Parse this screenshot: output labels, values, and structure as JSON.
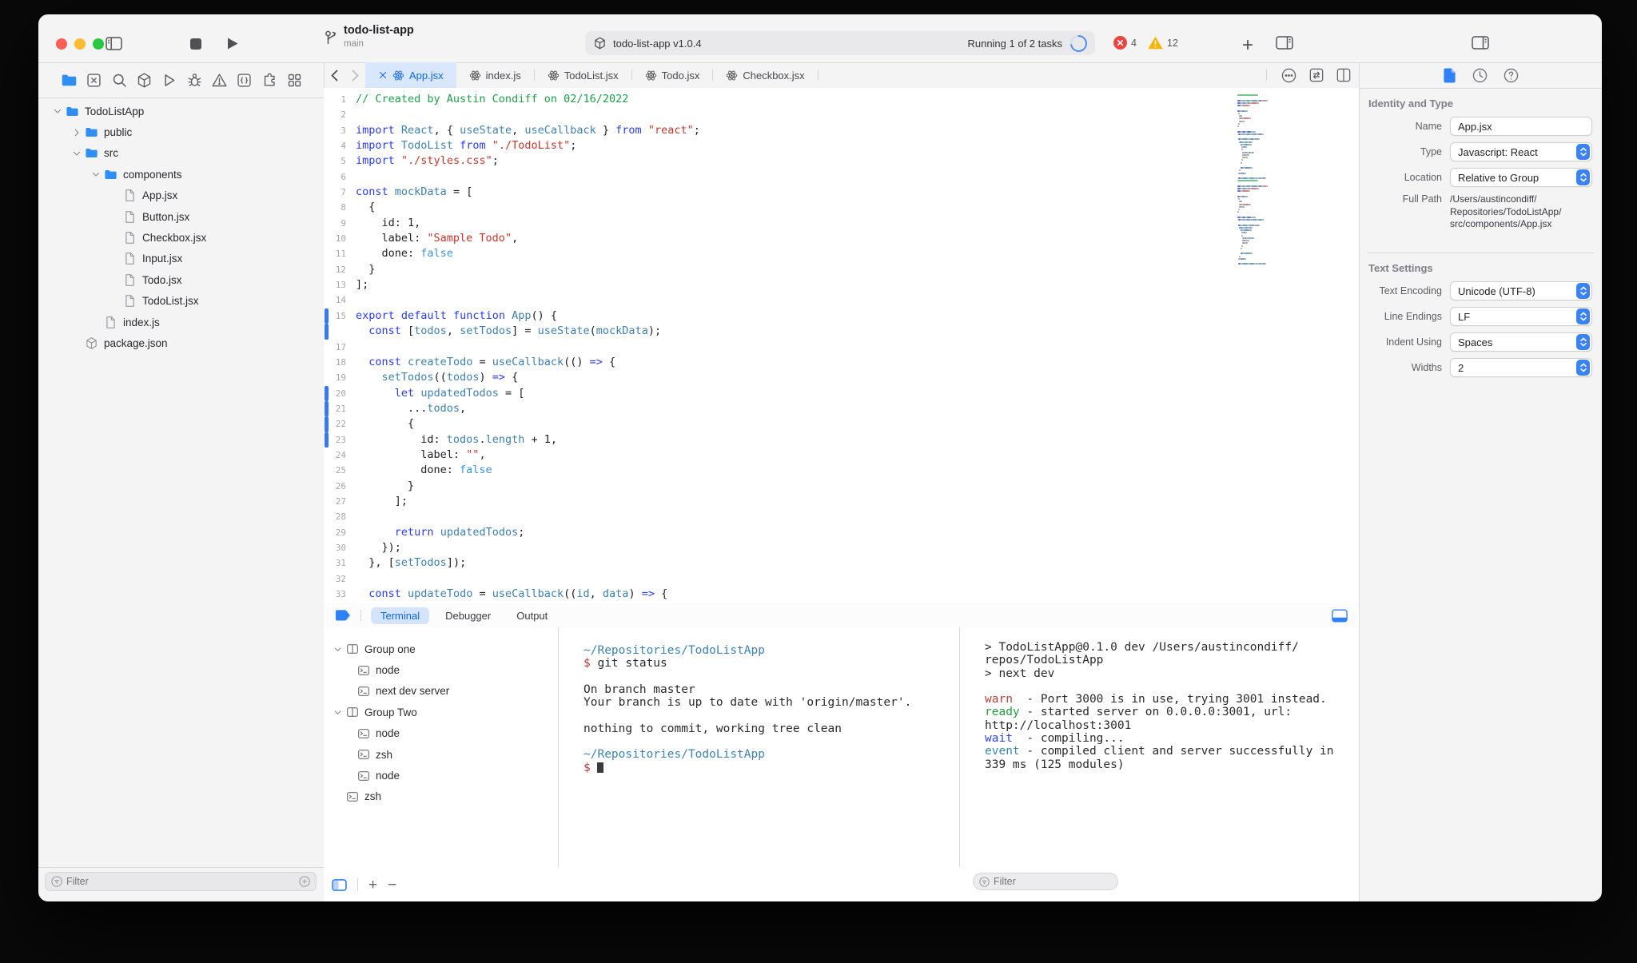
{
  "titlebar": {
    "project": "todo-list-app",
    "branch": "main",
    "status_left": "todo-list-app v1.0.4",
    "status_right": "Running 1 of 2 tasks",
    "errors": "4",
    "warnings": "12"
  },
  "navigator": {
    "filter_placeholder": "Filter",
    "tree": [
      {
        "label": "TodoListApp",
        "icon": "folder",
        "depth": 0,
        "chevron": "down"
      },
      {
        "label": "public",
        "icon": "folder",
        "depth": 1,
        "chevron": "right"
      },
      {
        "label": "src",
        "icon": "folder",
        "depth": 1,
        "chevron": "down"
      },
      {
        "label": "components",
        "icon": "folder",
        "depth": 2,
        "chevron": "down"
      },
      {
        "label": "App.jsx",
        "icon": "file",
        "depth": 3,
        "selected": true
      },
      {
        "label": "Button.jsx",
        "icon": "file",
        "depth": 3
      },
      {
        "label": "Checkbox.jsx",
        "icon": "file",
        "depth": 3
      },
      {
        "label": "Input.jsx",
        "icon": "file",
        "depth": 3
      },
      {
        "label": "Todo.jsx",
        "icon": "file",
        "depth": 3
      },
      {
        "label": "TodoList.jsx",
        "icon": "file",
        "depth": 3
      },
      {
        "label": "index.js",
        "icon": "file",
        "depth": 2
      },
      {
        "label": "package.json",
        "icon": "package",
        "depth": 1
      }
    ]
  },
  "tabs": [
    {
      "label": "App.jsx",
      "active": true
    },
    {
      "label": "index.js"
    },
    {
      "label": "TodoList.jsx"
    },
    {
      "label": "Todo.jsx"
    },
    {
      "label": "Checkbox.jsx"
    }
  ],
  "editor": {
    "lines": [
      {
        "n": "1",
        "seg": [
          [
            "cmt",
            "// Created by Austin Condiff on 02/16/2022"
          ]
        ]
      },
      {
        "n": "2",
        "seg": []
      },
      {
        "n": "3",
        "seg": [
          [
            "kw",
            "import"
          ],
          [
            "pln",
            " "
          ],
          [
            "id",
            "React"
          ],
          [
            "pln",
            ", { "
          ],
          [
            "id",
            "useState"
          ],
          [
            "pln",
            ", "
          ],
          [
            "id",
            "useCallback"
          ],
          [
            "pln",
            " } "
          ],
          [
            "kw",
            "from"
          ],
          [
            "pln",
            " "
          ],
          [
            "str",
            "\"react\""
          ],
          [
            "pln",
            ";"
          ]
        ]
      },
      {
        "n": "4",
        "seg": [
          [
            "kw",
            "import"
          ],
          [
            "pln",
            " "
          ],
          [
            "id",
            "TodoList"
          ],
          [
            "pln",
            " "
          ],
          [
            "kw",
            "from"
          ],
          [
            "pln",
            " "
          ],
          [
            "str",
            "\"./TodoList\""
          ],
          [
            "pln",
            ";"
          ]
        ]
      },
      {
        "n": "5",
        "seg": [
          [
            "kw",
            "import"
          ],
          [
            "pln",
            " "
          ],
          [
            "str",
            "\"./styles.css\""
          ],
          [
            "pln",
            ";"
          ]
        ]
      },
      {
        "n": "6",
        "seg": []
      },
      {
        "n": "7",
        "seg": [
          [
            "kw",
            "const"
          ],
          [
            "pln",
            " "
          ],
          [
            "id",
            "mockData"
          ],
          [
            "pln",
            " = ["
          ]
        ]
      },
      {
        "n": "8",
        "seg": [
          [
            "pln",
            "  {"
          ]
        ]
      },
      {
        "n": "9",
        "seg": [
          [
            "pln",
            "    id: 1,"
          ]
        ]
      },
      {
        "n": "10",
        "seg": [
          [
            "pln",
            "    label: "
          ],
          [
            "str",
            "\"Sample Todo\""
          ],
          [
            "pln",
            ","
          ]
        ]
      },
      {
        "n": "11",
        "seg": [
          [
            "pln",
            "    done: "
          ],
          [
            "lit",
            "false"
          ]
        ]
      },
      {
        "n": "12",
        "seg": [
          [
            "pln",
            "  }"
          ]
        ]
      },
      {
        "n": "13",
        "seg": [
          [
            "pln",
            "];"
          ]
        ]
      },
      {
        "n": "14",
        "seg": []
      },
      {
        "n": "15",
        "bar": true,
        "seg": [
          [
            "kw",
            "export"
          ],
          [
            "pln",
            " "
          ],
          [
            "kw",
            "default"
          ],
          [
            "pln",
            " "
          ],
          [
            "kw",
            "function"
          ],
          [
            "pln",
            " "
          ],
          [
            "id",
            "App"
          ],
          [
            "pln",
            "() {"
          ]
        ]
      },
      {
        "n": "",
        "bar": true,
        "seg": [
          [
            "pln",
            "  "
          ],
          [
            "kw",
            "const"
          ],
          [
            "pln",
            " ["
          ],
          [
            "id",
            "todos"
          ],
          [
            "pln",
            ", "
          ],
          [
            "id",
            "setTodos"
          ],
          [
            "pln",
            "] = "
          ],
          [
            "id",
            "useState"
          ],
          [
            "pln",
            "("
          ],
          [
            "id",
            "mockData"
          ],
          [
            "pln",
            ");"
          ]
        ]
      },
      {
        "n": "17",
        "seg": []
      },
      {
        "n": "18",
        "seg": [
          [
            "pln",
            "  "
          ],
          [
            "kw",
            "const"
          ],
          [
            "pln",
            " "
          ],
          [
            "id",
            "createTodo"
          ],
          [
            "pln",
            " = "
          ],
          [
            "id",
            "useCallback"
          ],
          [
            "pln",
            "(() "
          ],
          [
            "kw",
            "=>"
          ],
          [
            "pln",
            " {"
          ]
        ]
      },
      {
        "n": "19",
        "seg": [
          [
            "pln",
            "    "
          ],
          [
            "id",
            "setTodos"
          ],
          [
            "pln",
            "(("
          ],
          [
            "id",
            "todos"
          ],
          [
            "pln",
            ") "
          ],
          [
            "kw",
            "=>"
          ],
          [
            "pln",
            " {"
          ]
        ]
      },
      {
        "n": "20",
        "bar": true,
        "seg": [
          [
            "pln",
            "      "
          ],
          [
            "kw",
            "let"
          ],
          [
            "pln",
            " "
          ],
          [
            "id",
            "updatedTodos"
          ],
          [
            "pln",
            " = ["
          ]
        ]
      },
      {
        "n": "21",
        "bar": true,
        "seg": [
          [
            "pln",
            "        ..."
          ],
          [
            "id",
            "todos"
          ],
          [
            "pln",
            ","
          ]
        ]
      },
      {
        "n": "22",
        "bar": true,
        "seg": [
          [
            "pln",
            "        {"
          ]
        ]
      },
      {
        "n": "23",
        "bar": true,
        "seg": [
          [
            "pln",
            "          id: "
          ],
          [
            "id",
            "todos"
          ],
          [
            "pln",
            "."
          ],
          [
            "id",
            "length"
          ],
          [
            "pln",
            " + 1,"
          ]
        ]
      },
      {
        "n": "24",
        "seg": [
          [
            "pln",
            "          label: "
          ],
          [
            "str",
            "\"\""
          ],
          [
            "pln",
            ","
          ]
        ]
      },
      {
        "n": "25",
        "seg": [
          [
            "pln",
            "          done: "
          ],
          [
            "lit",
            "false"
          ]
        ]
      },
      {
        "n": "26",
        "seg": [
          [
            "pln",
            "        }"
          ]
        ]
      },
      {
        "n": "27",
        "seg": [
          [
            "pln",
            "      ];"
          ]
        ]
      },
      {
        "n": "28",
        "seg": []
      },
      {
        "n": "29",
        "seg": [
          [
            "pln",
            "      "
          ],
          [
            "kw",
            "return"
          ],
          [
            "pln",
            " "
          ],
          [
            "id",
            "updatedTodos"
          ],
          [
            "pln",
            ";"
          ]
        ]
      },
      {
        "n": "30",
        "seg": [
          [
            "pln",
            "    });"
          ]
        ]
      },
      {
        "n": "31",
        "seg": [
          [
            "pln",
            "  }, ["
          ],
          [
            "id",
            "setTodos"
          ],
          [
            "pln",
            "]);"
          ]
        ]
      },
      {
        "n": "32",
        "seg": []
      },
      {
        "n": "33",
        "seg": [
          [
            "pln",
            "  "
          ],
          [
            "kw",
            "const"
          ],
          [
            "pln",
            " "
          ],
          [
            "id",
            "updateTodo"
          ],
          [
            "pln",
            " = "
          ],
          [
            "id",
            "useCallback"
          ],
          [
            "pln",
            "(("
          ],
          [
            "id",
            "id"
          ],
          [
            "pln",
            ", "
          ],
          [
            "id",
            "data"
          ],
          [
            "pln",
            ") "
          ],
          [
            "kw",
            "=>"
          ],
          [
            "pln",
            " {"
          ]
        ]
      }
    ]
  },
  "inspector": {
    "identity_title": "Identity and Type",
    "rows_identity": [
      {
        "label": "Name",
        "value": "App.jsx",
        "control": "input"
      },
      {
        "label": "Type",
        "value": "Javascript: React",
        "control": "select"
      },
      {
        "label": "Location",
        "value": "Relative to Group",
        "control": "select"
      },
      {
        "label": "Full Path",
        "value": "/Users/austincondiff/\nRepositories/TodoListApp/\nsrc/components/App.jsx",
        "control": "text"
      }
    ],
    "text_title": "Text Settings",
    "rows_text": [
      {
        "label": "Text Encoding",
        "value": "Unicode (UTF-8)",
        "control": "select"
      },
      {
        "label": "Line Endings",
        "value": "LF",
        "control": "select"
      },
      {
        "label": "Indent Using",
        "value": "Spaces",
        "control": "select"
      },
      {
        "label": "Widths",
        "value": "2",
        "control": "select"
      }
    ]
  },
  "panel": {
    "tabs": [
      {
        "label": "Terminal",
        "active": true
      },
      {
        "label": "Debugger"
      },
      {
        "label": "Output"
      }
    ],
    "sessions": [
      {
        "label": "Group one",
        "type": "group"
      },
      {
        "label": "node",
        "type": "session",
        "selected": true,
        "indent": 1
      },
      {
        "label": "next dev server",
        "type": "session",
        "indent": 1
      },
      {
        "label": "Group Two",
        "type": "group"
      },
      {
        "label": "node",
        "type": "session",
        "indent": 1
      },
      {
        "label": "zsh",
        "type": "session",
        "indent": 1
      },
      {
        "label": "node",
        "type": "session",
        "indent": 1
      },
      {
        "label": "zsh",
        "type": "session",
        "indent": 0
      }
    ],
    "term1": [
      [
        [
          "path",
          "~/Repositories/TodoListApp"
        ]
      ],
      [
        [
          "prompt",
          "$"
        ],
        [
          "pln",
          " git status"
        ]
      ],
      [],
      [
        [
          "pln",
          "On branch master"
        ]
      ],
      [
        [
          "pln",
          "Your branch is up to date with 'origin/master'."
        ]
      ],
      [],
      [
        [
          "pln",
          "nothing to commit, working tree clean"
        ]
      ],
      [],
      [
        [
          "path",
          "~/Repositories/TodoListApp"
        ]
      ],
      [
        [
          "prompt",
          "$"
        ],
        [
          "pln",
          " "
        ],
        [
          "cursor",
          ""
        ]
      ]
    ],
    "term2": [
      [
        [
          "pln",
          "> TodoListApp@0.1.0 dev /Users/austincondiff/"
        ]
      ],
      [
        [
          "pln",
          "repos/TodoListApp"
        ]
      ],
      [
        [
          "pln",
          "> next dev"
        ]
      ],
      [],
      [
        [
          "warn",
          "warn"
        ],
        [
          "pln",
          "  - Port 3000 is in use, trying 3001 instead."
        ]
      ],
      [
        [
          "ready",
          "ready"
        ],
        [
          "pln",
          " - started server on 0.0.0.0:3001, url:"
        ]
      ],
      [
        [
          "pln",
          "http://localhost:3001"
        ]
      ],
      [
        [
          "wait",
          "wait"
        ],
        [
          "pln",
          "  - compiling..."
        ]
      ],
      [
        [
          "event",
          "event"
        ],
        [
          "pln",
          " - compiled client and server successfully in"
        ]
      ],
      [
        [
          "pln",
          "339 ms (125 modules)"
        ]
      ]
    ],
    "filter_placeholder": "Filter"
  }
}
